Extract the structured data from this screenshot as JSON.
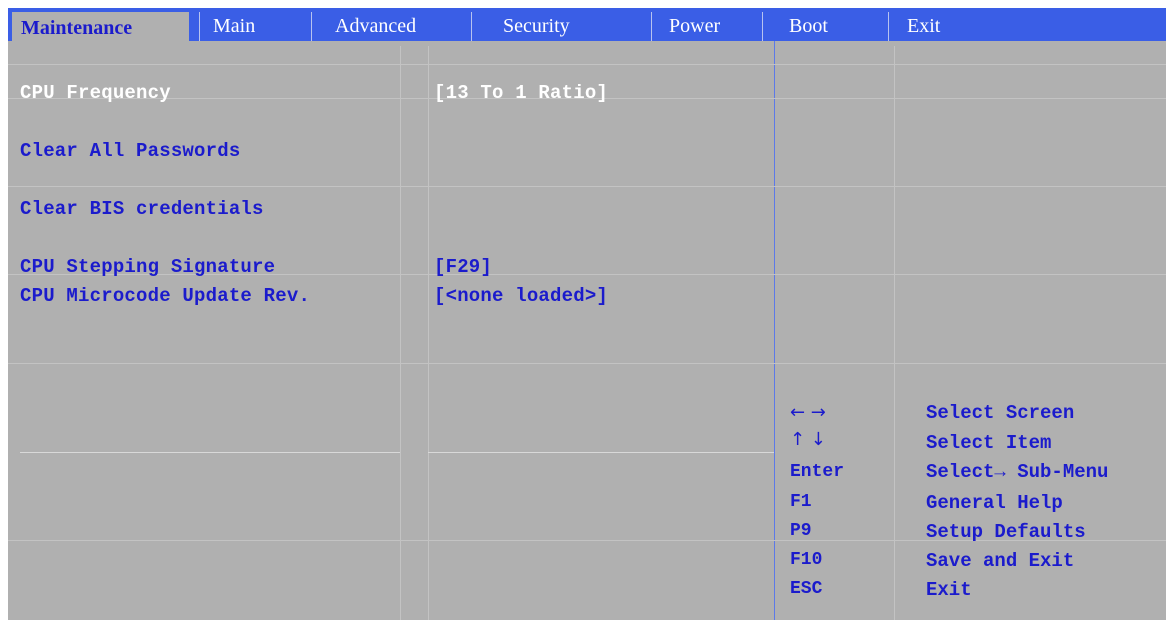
{
  "tabs": [
    {
      "label": "Maintenance",
      "active": true
    },
    {
      "label": "Main"
    },
    {
      "label": "Advanced"
    },
    {
      "label": "Security"
    },
    {
      "label": "Power"
    },
    {
      "label": "Boot"
    },
    {
      "label": "Exit"
    }
  ],
  "menu": {
    "cpu_frequency": {
      "label": "CPU Frequency",
      "value": "[13 To 1 Ratio]"
    },
    "clear_all_passwords": {
      "label": "Clear All Passwords"
    },
    "clear_bis_credentials": {
      "label": "Clear BIS credentials"
    },
    "cpu_stepping_signature": {
      "label": "CPU Stepping Signature",
      "value": "[F29]"
    },
    "cpu_microcode_update_rev": {
      "label": "CPU Microcode Update Rev.",
      "value": "[<none loaded>]"
    }
  },
  "help": [
    {
      "key": "← →",
      "action": "Select Screen"
    },
    {
      "key": "↑ ↓",
      "action": "Select Item"
    },
    {
      "key": "Enter",
      "action": "Select→ Sub-Menu"
    },
    {
      "key": "F1",
      "action": "General Help"
    },
    {
      "key": "P9",
      "action": "Setup Defaults"
    },
    {
      "key": "F10",
      "action": "Save and Exit"
    },
    {
      "key": "ESC",
      "action": "Exit"
    }
  ],
  "colors": {
    "tabbar": "#3a5ee6",
    "background": "#b0b0b0",
    "text_blue": "#1b1bcc",
    "text_white": "#ffffff"
  }
}
